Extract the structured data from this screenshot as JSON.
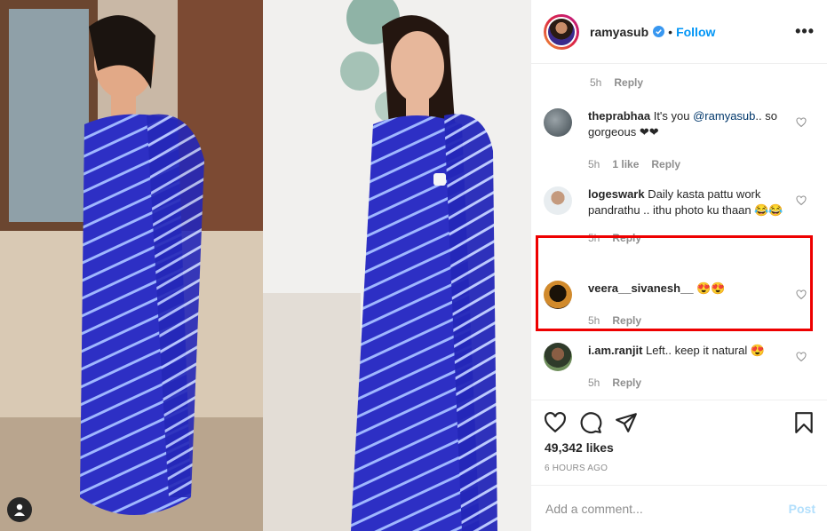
{
  "post": {
    "username": "ramyasub",
    "follow_label": "Follow",
    "separator": "•",
    "more_label": "•••",
    "likes": "49,342 likes",
    "time_ago": "6 HOURS AGO"
  },
  "comments": [
    {
      "meta_time": "5h",
      "meta_reply": "Reply"
    },
    {
      "username": "theprabhaa",
      "text": "It's you",
      "mention": "@ramyasub",
      "text_after": ".. so gorgeous ❤❤",
      "time": "5h",
      "likes": "1 like",
      "reply": "Reply"
    },
    {
      "username": "logeswark",
      "text": "Daily kasta pattu work pandrathu .. ithu photo ku thaan 😂😂",
      "time": "5h",
      "reply": "Reply"
    },
    {
      "username": "veera__sivanesh__",
      "text": "😍😍",
      "time": "5h",
      "reply": "Reply"
    },
    {
      "username": "i.am.ranjit",
      "text": "Left.. keep it natural 😍",
      "time": "5h",
      "reply": "Reply"
    }
  ],
  "add_comment": {
    "placeholder": "Add a comment...",
    "post_label": "Post"
  },
  "icons": {
    "like": "heart-icon",
    "comment": "comment-bubble-icon",
    "share": "paper-plane-icon",
    "save": "bookmark-icon",
    "verified": "verified-badge-icon",
    "user_tag": "user-tag-icon"
  },
  "colors": {
    "accent": "#0095f6",
    "highlight_box": "#ee0000",
    "saree": "#2b2fc8"
  }
}
